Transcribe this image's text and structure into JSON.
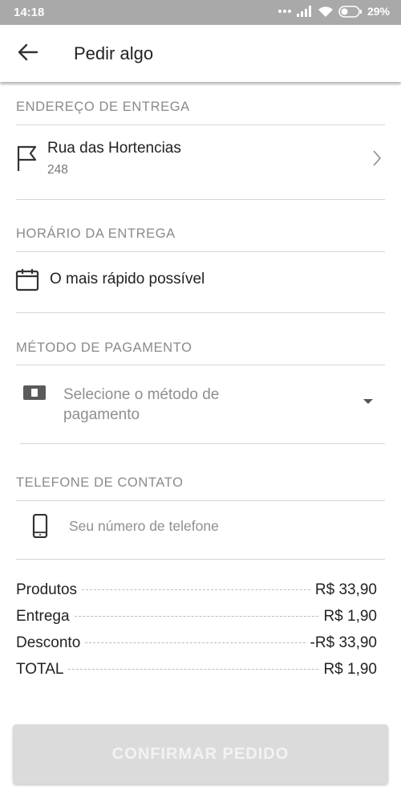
{
  "status_bar": {
    "time": "14:18",
    "battery": "29%",
    "icons": [
      "dots-icon",
      "signal-icon",
      "wifi-icon",
      "battery-icon"
    ]
  },
  "app_bar": {
    "title": "Pedir algo",
    "back_icon": "arrow-left-icon"
  },
  "delivery_address": {
    "header": "ENDEREÇO DE ENTREGA",
    "street": "Rua das Hortencias",
    "number": "248",
    "icon": "flag-icon"
  },
  "delivery_time": {
    "header": "HORÁRIO DA ENTREGA",
    "value": "O mais rápido possível",
    "icon": "calendar-icon"
  },
  "payment_method": {
    "header": "MÉTODO DE PAGAMENTO",
    "line1": "Selecione o método de",
    "line2": "pagamento",
    "icon": "card-icon"
  },
  "contact_phone": {
    "header": "TELEFONE DE CONTATO",
    "placeholder": "Seu número de telefone",
    "value": "",
    "icon": "phone-icon"
  },
  "summary": {
    "rows": [
      {
        "label": "Produtos",
        "value": "R$ 33,90"
      },
      {
        "label": "Entrega",
        "value": "R$ 1,90"
      },
      {
        "label": "Desconto",
        "value": "-R$ 33,90"
      },
      {
        "label": "TOTAL",
        "value": "R$ 1,90"
      }
    ]
  },
  "confirm_button": {
    "label": "CONFIRMAR PEDIDO"
  },
  "colors": {
    "status_bar": "#a9a9a9",
    "button_disabled": "#dbdbdb",
    "header_text": "#8a8a8a",
    "divider": "#d6d6d6"
  }
}
